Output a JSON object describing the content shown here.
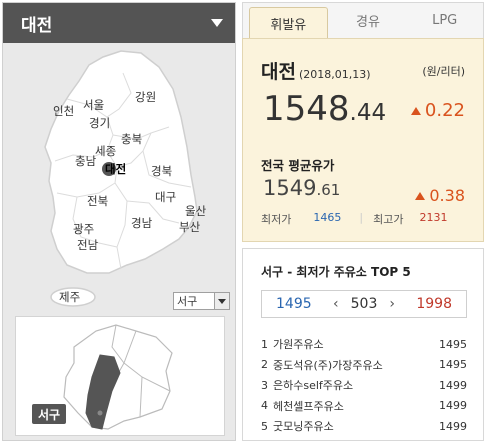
{
  "region_selector": {
    "title": "대전"
  },
  "map": {
    "labels": [
      "서울",
      "인천",
      "경기",
      "강원",
      "충북",
      "세종",
      "충남",
      "대전",
      "경북",
      "전북",
      "대구",
      "울산",
      "광주",
      "경남",
      "부산",
      "전남",
      "제주"
    ],
    "active": "대전"
  },
  "district_select": {
    "value": "서구"
  },
  "district_badge": "서구",
  "tabs": [
    {
      "label": "휘발유",
      "active": true
    },
    {
      "label": "경유",
      "active": false
    },
    {
      "label": "LPG",
      "active": false
    }
  ],
  "local": {
    "city": "대전",
    "date": "(2018,01,13)",
    "unit": "(원/리터)",
    "price_int": "1548",
    "price_dec": ".44",
    "change": "0.22"
  },
  "national": {
    "title": "전국 평균유가",
    "price_int": "1549",
    "price_dec": ".61",
    "change": "0.38",
    "min_label": "최저가",
    "min_value": "1465",
    "max_label": "최고가",
    "max_value": "2131"
  },
  "top5": {
    "title": "서구 - 최저가 주유소 TOP 5",
    "range_low": "1495",
    "range_mid": "503",
    "range_high": "1998",
    "stations": [
      {
        "rank": "1",
        "name": "가원주유소",
        "price": "1495"
      },
      {
        "rank": "2",
        "name": "중도석유(주)가장주유소",
        "price": "1495"
      },
      {
        "rank": "3",
        "name": "은하수self주유소",
        "price": "1499"
      },
      {
        "rank": "4",
        "name": "헤천셀프주유소",
        "price": "1499"
      },
      {
        "rank": "5",
        "name": "굿모닝주유소",
        "price": "1499"
      }
    ]
  },
  "colors": {
    "accent_up": "#d9531e",
    "min": "#2a66b0",
    "max": "#c0392b",
    "panel": "#fbf3dc"
  }
}
